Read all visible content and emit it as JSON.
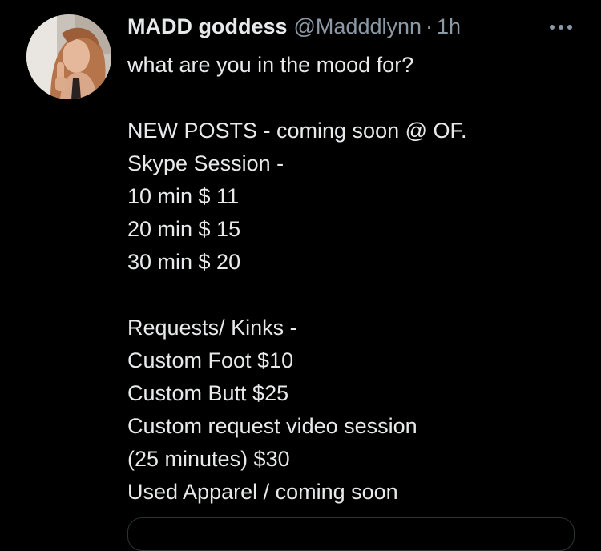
{
  "tweet": {
    "author": {
      "display_name": "MADD goddess",
      "handle": "@Madddlynn",
      "separator": "·",
      "time": "1h"
    },
    "more_icon": "more-horizontal-icon",
    "text_lines": [
      "what are you in the mood for?",
      "",
      "NEW POSTS - coming soon @ OF.",
      "Skype Session -",
      "10 min $ 11",
      "20 min $ 15",
      "30 min $ 20",
      "",
      "Requests/ Kinks -",
      "Custom Foot $10",
      "Custom Butt $25",
      "Custom request video session",
      "(25 minutes) $30",
      "Used Apparel / coming soon"
    ]
  },
  "colors": {
    "background": "#000000",
    "primary_text": "#e7e9ea",
    "secondary_text": "#8b98a5",
    "border": "#2f3336"
  }
}
